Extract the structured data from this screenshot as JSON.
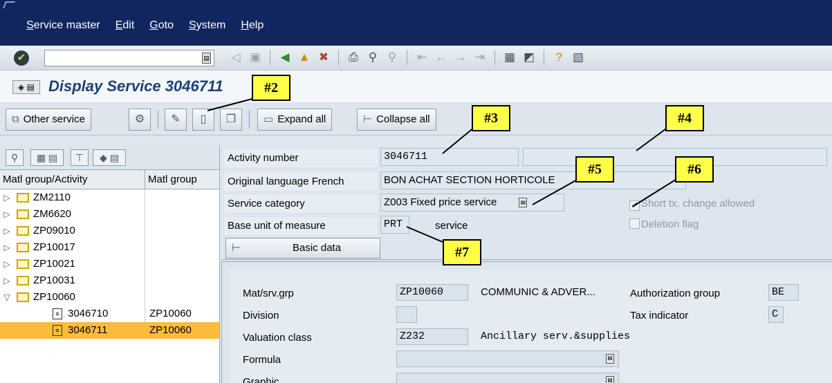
{
  "menu": [
    "Service master",
    "Edit",
    "Goto",
    "System",
    "Help"
  ],
  "command_field": {
    "value": ""
  },
  "std_toolbar_icons": [
    "back-icon",
    "save-icon",
    "back-arrow-icon",
    "exit-icon",
    "cancel-icon",
    "print-icon",
    "find-icon",
    "find-next-icon",
    "first-page-icon",
    "previous-page-icon",
    "next-page-icon",
    "last-page-icon",
    "create-session-icon",
    "shortcut-icon",
    "help-icon",
    "layout-icon"
  ],
  "title": "Display Service 3046711",
  "app_toolbar": {
    "other_service": "Other service",
    "expand_all": "Expand all",
    "collapse_all": "Collapse all"
  },
  "tree": {
    "col1": "Matl group/Activity",
    "col2": "Matl group",
    "rows": [
      {
        "label": "ZM2110",
        "group": "",
        "type": "folder",
        "expanded": false
      },
      {
        "label": "ZM6620",
        "group": "",
        "type": "folder",
        "expanded": false
      },
      {
        "label": "ZP09010",
        "group": "",
        "type": "folder",
        "expanded": false
      },
      {
        "label": "ZP10017",
        "group": "",
        "type": "folder",
        "expanded": false
      },
      {
        "label": "ZP10021",
        "group": "",
        "type": "folder",
        "expanded": false
      },
      {
        "label": "ZP10031",
        "group": "",
        "type": "folder",
        "expanded": false
      },
      {
        "label": "ZP10060",
        "group": "",
        "type": "folder",
        "expanded": true
      },
      {
        "label": "3046710",
        "group": "ZP10060",
        "type": "doc",
        "selected": false
      },
      {
        "label": "3046711",
        "group": "ZP10060",
        "type": "doc",
        "selected": true
      }
    ]
  },
  "header": {
    "activity_number_label": "Activity number",
    "activity_number": "3046711",
    "activity_number_ext": "",
    "original_language_label": "Original language French",
    "original_language_text": "BON ACHAT SECTION HORTICOLE",
    "service_category_label": "Service category",
    "service_category": "Z003 Fixed price service",
    "base_uom_label": "Base unit of measure",
    "base_uom": "PRT",
    "base_uom_text": "service",
    "short_text_change": "Short tx. change allowed",
    "short_text_change_checked": true,
    "deletion_flag": "Deletion flag",
    "deletion_flag_checked": false,
    "basic_data_button": "Basic data"
  },
  "basic_data": {
    "matsrv_grp_label": "Mat/srv.grp",
    "matsrv_grp": "ZP10060",
    "matsrv_grp_text": "COMMUNIC & ADVER...",
    "auth_group_label": "Authorization group",
    "auth_group": "BE",
    "division_label": "Division",
    "division": "",
    "tax_indicator_label": "Tax indicator",
    "tax_indicator": "C",
    "valuation_class_label": "Valuation class",
    "valuation_class": "Z232",
    "valuation_class_text": "Ancillary serv.&supplies",
    "formula_label": "Formula",
    "graphic_label": "Graphic"
  },
  "callouts": [
    "#2",
    "#3",
    "#4",
    "#5",
    "#6",
    "#7"
  ],
  "colors": {
    "menubar": "#11265f",
    "selection": "#fdbb3a",
    "callout": "#ffff4a",
    "title": "#1f3f76"
  }
}
